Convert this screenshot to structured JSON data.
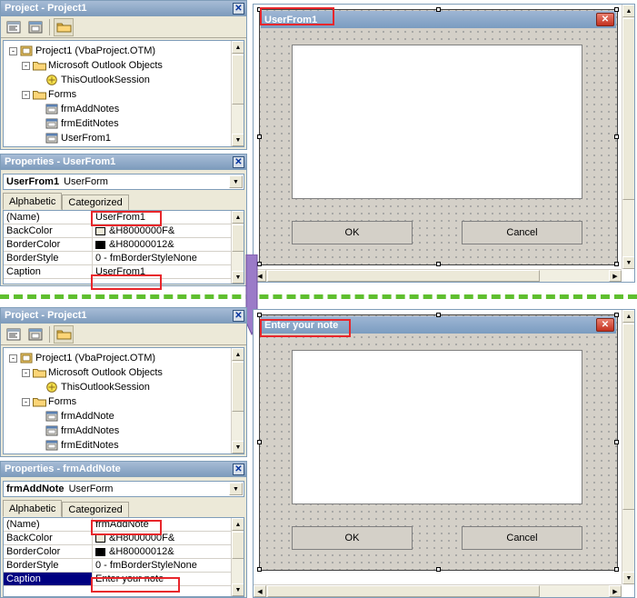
{
  "top": {
    "project_panel": {
      "title": "Project - Project1",
      "close_label": "✕",
      "toolbar": [
        {
          "name": "view-code-button",
          "icon": "code-window-icon"
        },
        {
          "name": "view-object-button",
          "icon": "object-window-icon"
        },
        {
          "name": "toggle-folders-button",
          "icon": "folder-icon"
        }
      ],
      "tree": [
        {
          "indent": 0,
          "expander": "-",
          "icon": "project-icon",
          "label": "Project1 (VbaProject.OTM)"
        },
        {
          "indent": 1,
          "expander": "-",
          "icon": "folder-icon",
          "label": "Microsoft Outlook Objects"
        },
        {
          "indent": 2,
          "expander": "",
          "icon": "module-icon",
          "label": "ThisOutlookSession"
        },
        {
          "indent": 1,
          "expander": "-",
          "icon": "folder-icon",
          "label": "Forms"
        },
        {
          "indent": 2,
          "expander": "",
          "icon": "form-icon",
          "label": "frmAddNotes"
        },
        {
          "indent": 2,
          "expander": "",
          "icon": "form-icon",
          "label": "frmEditNotes"
        },
        {
          "indent": 2,
          "expander": "",
          "icon": "form-icon",
          "label": "UserFrom1"
        }
      ]
    },
    "properties_panel": {
      "title": "Properties - UserFrom1",
      "close_label": "✕",
      "object_name": "UserFrom1",
      "object_type": "UserForm",
      "tabs": [
        {
          "label": "Alphabetic",
          "active": true
        },
        {
          "label": "Categorized",
          "active": false
        }
      ],
      "rows": [
        {
          "name": "(Name)",
          "value": "UserFrom1",
          "selected": false,
          "highlight": true,
          "swatch": ""
        },
        {
          "name": "BackColor",
          "value": "&H8000000F&",
          "selected": false,
          "highlight": false,
          "swatch": "#ece9d8"
        },
        {
          "name": "BorderColor",
          "value": "&H80000012&",
          "selected": false,
          "highlight": false,
          "swatch": "#000000"
        },
        {
          "name": "BorderStyle",
          "value": "0 - fmBorderStyleNone",
          "selected": false,
          "highlight": false,
          "swatch": ""
        },
        {
          "name": "Caption",
          "value": "UserFrom1",
          "selected": false,
          "highlight": true,
          "swatch": ""
        }
      ]
    },
    "designer": {
      "form_caption": "UserFrom1",
      "close_label": "✕",
      "buttons": [
        {
          "label": "OK",
          "name": "ok-button"
        },
        {
          "label": "Cancel",
          "name": "cancel-button"
        }
      ]
    }
  },
  "bottom": {
    "project_panel": {
      "title": "Project - Project1",
      "close_label": "✕",
      "toolbar": [
        {
          "name": "view-code-button",
          "icon": "code-window-icon"
        },
        {
          "name": "view-object-button",
          "icon": "object-window-icon"
        },
        {
          "name": "toggle-folders-button",
          "icon": "folder-icon"
        }
      ],
      "tree": [
        {
          "indent": 0,
          "expander": "-",
          "icon": "project-icon",
          "label": "Project1 (VbaProject.OTM)"
        },
        {
          "indent": 1,
          "expander": "-",
          "icon": "folder-icon",
          "label": "Microsoft Outlook Objects"
        },
        {
          "indent": 2,
          "expander": "",
          "icon": "module-icon",
          "label": "ThisOutlookSession"
        },
        {
          "indent": 1,
          "expander": "-",
          "icon": "folder-icon",
          "label": "Forms"
        },
        {
          "indent": 2,
          "expander": "",
          "icon": "form-icon",
          "label": "frmAddNote"
        },
        {
          "indent": 2,
          "expander": "",
          "icon": "form-icon",
          "label": "frmAddNotes"
        },
        {
          "indent": 2,
          "expander": "",
          "icon": "form-icon",
          "label": "frmEditNotes"
        }
      ]
    },
    "properties_panel": {
      "title": "Properties - frmAddNote",
      "close_label": "✕",
      "object_name": "frmAddNote",
      "object_type": "UserForm",
      "tabs": [
        {
          "label": "Alphabetic",
          "active": true
        },
        {
          "label": "Categorized",
          "active": false
        }
      ],
      "rows": [
        {
          "name": "(Name)",
          "value": "frmAddNote",
          "selected": false,
          "highlight": true,
          "swatch": ""
        },
        {
          "name": "BackColor",
          "value": "&H8000000F&",
          "selected": false,
          "highlight": false,
          "swatch": "#ece9d8"
        },
        {
          "name": "BorderColor",
          "value": "&H80000012&",
          "selected": false,
          "highlight": false,
          "swatch": "#000000"
        },
        {
          "name": "BorderStyle",
          "value": "0 - fmBorderStyleNone",
          "selected": false,
          "highlight": false,
          "swatch": ""
        },
        {
          "name": "Caption",
          "value": "Enter your note",
          "selected": true,
          "highlight": true,
          "swatch": ""
        }
      ]
    },
    "designer": {
      "form_caption": "Enter your note",
      "close_label": "✕",
      "buttons": [
        {
          "label": "OK",
          "name": "ok-button"
        },
        {
          "label": "Cancel",
          "name": "cancel-button"
        }
      ]
    }
  },
  "annotation": {
    "separator_color": "#5fbf2f",
    "arrow_color": "#8f6fbf",
    "highlight_color": "#e8262b"
  }
}
